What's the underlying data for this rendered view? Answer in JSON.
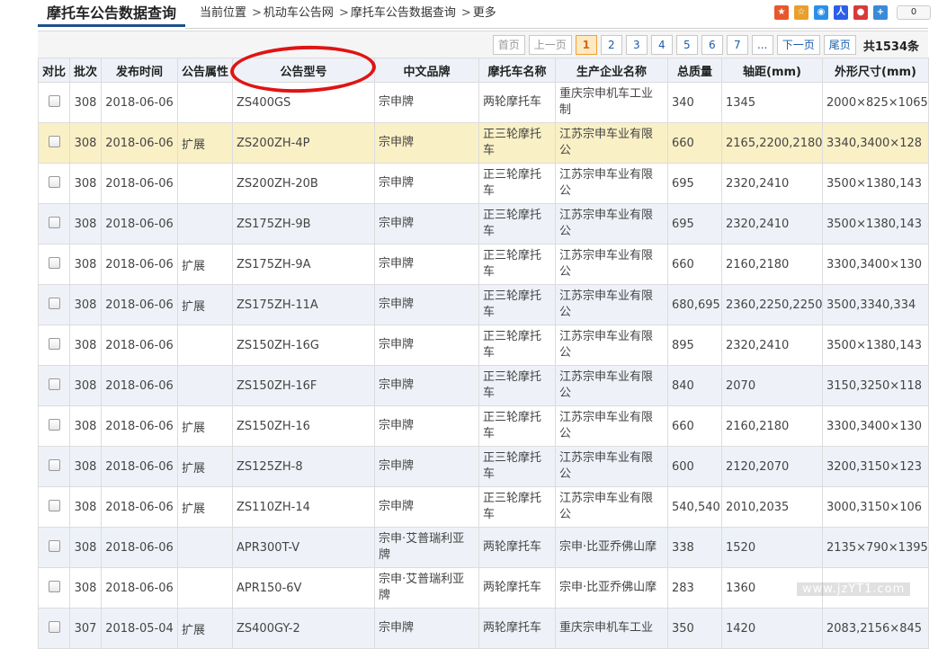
{
  "header": {
    "title": "摩托车公告数据查询",
    "breadcrumb": [
      "当前位置",
      "机动车公告网",
      "摩托车公告数据查询",
      "更多"
    ],
    "share_count": "0"
  },
  "pager": {
    "first": "首页",
    "prev": "上一页",
    "pages": [
      "1",
      "2",
      "3",
      "4",
      "5",
      "6",
      "7",
      "..."
    ],
    "next": "下一页",
    "last": "尾页",
    "total": "共1534条"
  },
  "table": {
    "columns": [
      "对比",
      "批次",
      "发布时间",
      "公告属性",
      "公告型号",
      "中文品牌",
      "摩托车名称",
      "生产企业名称",
      "总质量",
      "轴距(mm)",
      "外形尺寸(mm)"
    ],
    "rows": [
      {
        "batch": "308",
        "date": "2018-06-06",
        "attr": "",
        "model": "ZS400GS",
        "brand": "宗申牌",
        "name": "两轮摩托车",
        "maker": "重庆宗申机车工业制",
        "mass": "340",
        "wheelbase": "1345",
        "size": "2000×825×1065"
      },
      {
        "batch": "308",
        "date": "2018-06-06",
        "attr": "扩展",
        "model": "ZS200ZH-4P",
        "brand": "宗申牌",
        "name": "正三轮摩托车",
        "maker": "江苏宗申车业有限公",
        "mass": "660",
        "wheelbase": "2165,2200,2180",
        "size": "3340,3400×128"
      },
      {
        "batch": "308",
        "date": "2018-06-06",
        "attr": "",
        "model": "ZS200ZH-20B",
        "brand": "宗申牌",
        "name": "正三轮摩托车",
        "maker": "江苏宗申车业有限公",
        "mass": "695",
        "wheelbase": "2320,2410",
        "size": "3500×1380,143"
      },
      {
        "batch": "308",
        "date": "2018-06-06",
        "attr": "",
        "model": "ZS175ZH-9B",
        "brand": "宗申牌",
        "name": "正三轮摩托车",
        "maker": "江苏宗申车业有限公",
        "mass": "695",
        "wheelbase": "2320,2410",
        "size": "3500×1380,143"
      },
      {
        "batch": "308",
        "date": "2018-06-06",
        "attr": "扩展",
        "model": "ZS175ZH-9A",
        "brand": "宗申牌",
        "name": "正三轮摩托车",
        "maker": "江苏宗申车业有限公",
        "mass": "660",
        "wheelbase": "2160,2180",
        "size": "3300,3400×130"
      },
      {
        "batch": "308",
        "date": "2018-06-06",
        "attr": "扩展",
        "model": "ZS175ZH-11A",
        "brand": "宗申牌",
        "name": "正三轮摩托车",
        "maker": "江苏宗申车业有限公",
        "mass": "680,695",
        "wheelbase": "2360,2250,2250",
        "size": "3500,3340,334"
      },
      {
        "batch": "308",
        "date": "2018-06-06",
        "attr": "",
        "model": "ZS150ZH-16G",
        "brand": "宗申牌",
        "name": "正三轮摩托车",
        "maker": "江苏宗申车业有限公",
        "mass": "895",
        "wheelbase": "2320,2410",
        "size": "3500×1380,143"
      },
      {
        "batch": "308",
        "date": "2018-06-06",
        "attr": "",
        "model": "ZS150ZH-16F",
        "brand": "宗申牌",
        "name": "正三轮摩托车",
        "maker": "江苏宗申车业有限公",
        "mass": "840",
        "wheelbase": "2070",
        "size": "3150,3250×118"
      },
      {
        "batch": "308",
        "date": "2018-06-06",
        "attr": "扩展",
        "model": "ZS150ZH-16",
        "brand": "宗申牌",
        "name": "正三轮摩托车",
        "maker": "江苏宗申车业有限公",
        "mass": "660",
        "wheelbase": "2160,2180",
        "size": "3300,3400×130"
      },
      {
        "batch": "308",
        "date": "2018-06-06",
        "attr": "扩展",
        "model": "ZS125ZH-8",
        "brand": "宗申牌",
        "name": "正三轮摩托车",
        "maker": "江苏宗申车业有限公",
        "mass": "600",
        "wheelbase": "2120,2070",
        "size": "3200,3150×123"
      },
      {
        "batch": "308",
        "date": "2018-06-06",
        "attr": "扩展",
        "model": "ZS110ZH-14",
        "brand": "宗申牌",
        "name": "正三轮摩托车",
        "maker": "江苏宗申车业有限公",
        "mass": "540,540",
        "wheelbase": "2010,2035",
        "size": "3000,3150×106"
      },
      {
        "batch": "308",
        "date": "2018-06-06",
        "attr": "",
        "model": "APR300T-V",
        "brand": "宗申·艾普瑞利亚牌",
        "name": "两轮摩托车",
        "maker": "宗申·比亚乔佛山摩",
        "mass": "338",
        "wheelbase": "1520",
        "size": "2135×790×1395"
      },
      {
        "batch": "308",
        "date": "2018-06-06",
        "attr": "",
        "model": "APR150-6V",
        "brand": "宗申·艾普瑞利亚牌",
        "name": "两轮摩托车",
        "maker": "宗申·比亚乔佛山摩",
        "mass": "283",
        "wheelbase": "1360",
        "size": ""
      },
      {
        "batch": "307",
        "date": "2018-05-04",
        "attr": "扩展",
        "model": "ZS400GY-2",
        "brand": "宗申牌",
        "name": "两轮摩托车",
        "maker": "重庆宗申机车工业",
        "mass": "350",
        "wheelbase": "1420",
        "size": "2083,2156×845"
      }
    ]
  },
  "watermark": "www.jzYT1.com",
  "colors": {
    "accent": "#1f4e8c",
    "highlight_row": "#faf0c6",
    "alt_row": "#eef2f8",
    "annotation": "#e01414"
  }
}
